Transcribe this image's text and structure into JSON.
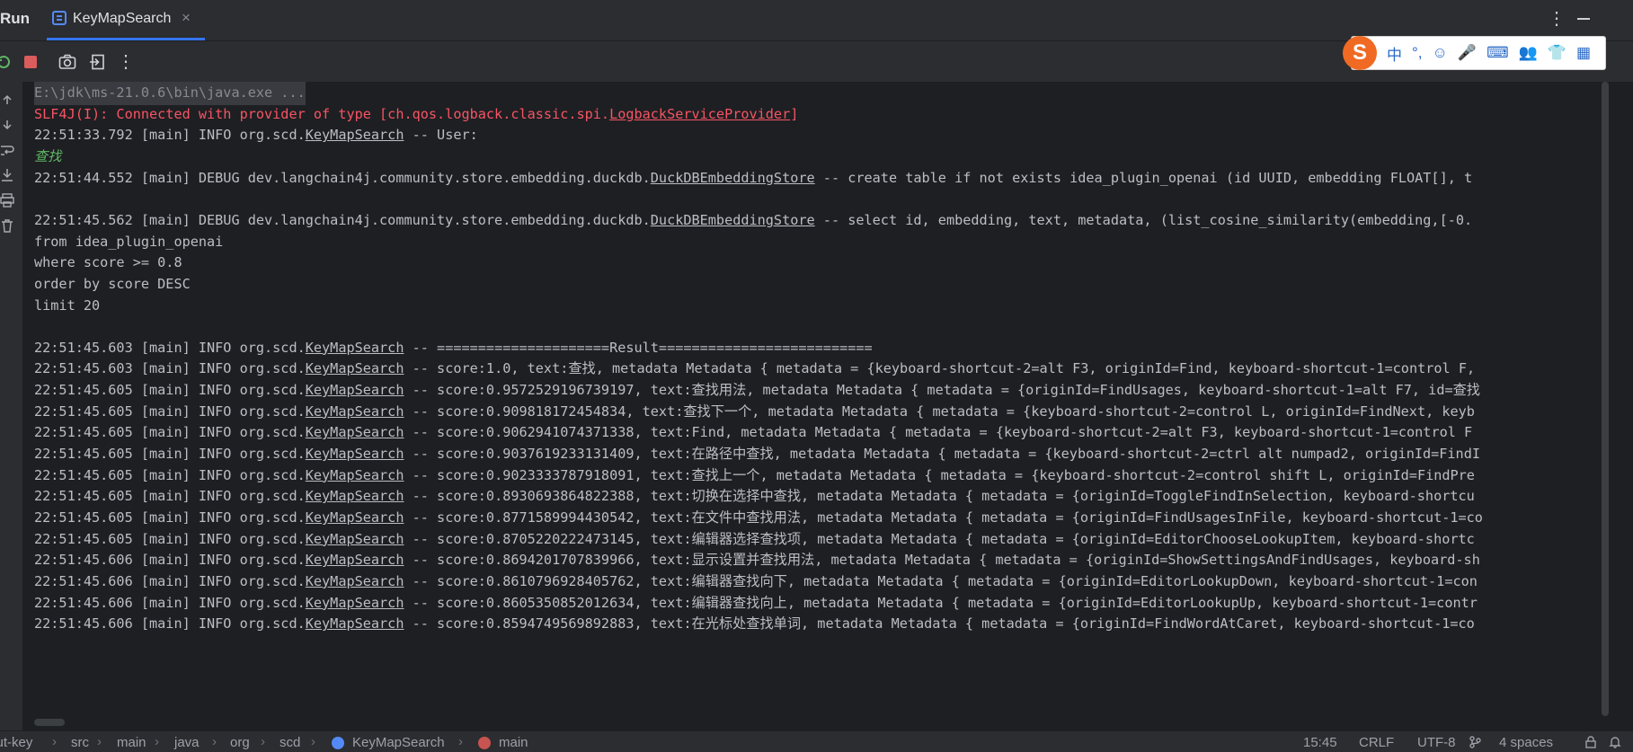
{
  "panel": {
    "title": "Run"
  },
  "tab": {
    "label": "KeyMapSearch",
    "close": "×"
  },
  "window": {
    "more": "⋮"
  },
  "toolbar": {
    "more": "⋮"
  },
  "ime": {
    "logo": "S",
    "items": [
      "中",
      "°,",
      "☺",
      "🎤",
      "⌨",
      "👥",
      "👕",
      "▦"
    ]
  },
  "console": {
    "lines": [
      {
        "style": "gray",
        "parts": [
          {
            "t": "E:\\jdk\\ms-21.0.6\\bin\\java.exe ..."
          }
        ]
      },
      {
        "style": "red",
        "parts": [
          {
            "t": "SLF4J(I): Connected with provider of type [ch.qos.logback.classic.spi."
          },
          {
            "t": "LogbackServiceProvider",
            "link": true
          },
          {
            "t": "]"
          }
        ]
      },
      {
        "style": "normal",
        "parts": [
          {
            "t": "22:51:33.792 [main] INFO org.scd."
          },
          {
            "t": "KeyMapSearch",
            "link": true
          },
          {
            "t": " -- User:"
          }
        ]
      },
      {
        "style": "green",
        "parts": [
          {
            "t": "查找"
          }
        ]
      },
      {
        "style": "normal",
        "parts": [
          {
            "t": "22:51:44.552 [main] DEBUG dev.langchain4j.community.store.embedding.duckdb."
          },
          {
            "t": "DuckDBEmbeddingStore",
            "link": true
          },
          {
            "t": " -- create table if not exists idea_plugin_openai (id UUID, embedding FLOAT[], t"
          }
        ]
      },
      {
        "style": "normal",
        "parts": [
          {
            "t": ""
          }
        ]
      },
      {
        "style": "normal",
        "parts": [
          {
            "t": "22:51:45.562 [main] DEBUG dev.langchain4j.community.store.embedding.duckdb."
          },
          {
            "t": "DuckDBEmbeddingStore",
            "link": true
          },
          {
            "t": " -- select id, embedding, text, metadata, (list_cosine_similarity(embedding,[-0."
          }
        ]
      },
      {
        "style": "normal",
        "parts": [
          {
            "t": "from idea_plugin_openai"
          }
        ]
      },
      {
        "style": "normal",
        "parts": [
          {
            "t": "where score >= 0.8"
          }
        ]
      },
      {
        "style": "normal",
        "parts": [
          {
            "t": "order by score DESC"
          }
        ]
      },
      {
        "style": "normal",
        "parts": [
          {
            "t": "limit 20"
          }
        ]
      },
      {
        "style": "normal",
        "parts": [
          {
            "t": ""
          }
        ]
      },
      {
        "style": "normal",
        "parts": [
          {
            "t": "22:51:45.603 [main] INFO org.scd."
          },
          {
            "t": "KeyMapSearch",
            "link": true
          },
          {
            "t": " -- =====================Result=========================="
          }
        ]
      },
      {
        "style": "normal",
        "parts": [
          {
            "t": "22:51:45.603 [main] INFO org.scd."
          },
          {
            "t": "KeyMapSearch",
            "link": true
          },
          {
            "t": " -- score:1.0, text:查找, metadata Metadata { metadata = {keyboard-shortcut-2=alt F3, originId=Find, keyboard-shortcut-1=control F,"
          }
        ]
      },
      {
        "style": "normal",
        "parts": [
          {
            "t": "22:51:45.605 [main] INFO org.scd."
          },
          {
            "t": "KeyMapSearch",
            "link": true
          },
          {
            "t": " -- score:0.9572529196739197, text:查找用法, metadata Metadata { metadata = {originId=FindUsages, keyboard-shortcut-1=alt F7, id=查找"
          }
        ]
      },
      {
        "style": "normal",
        "parts": [
          {
            "t": "22:51:45.605 [main] INFO org.scd."
          },
          {
            "t": "KeyMapSearch",
            "link": true
          },
          {
            "t": " -- score:0.909818172454834, text:查找下一个, metadata Metadata { metadata = {keyboard-shortcut-2=control L, originId=FindNext, keyb"
          }
        ]
      },
      {
        "style": "normal",
        "parts": [
          {
            "t": "22:51:45.605 [main] INFO org.scd."
          },
          {
            "t": "KeyMapSearch",
            "link": true
          },
          {
            "t": " -- score:0.9062941074371338, text:Find, metadata Metadata { metadata = {keyboard-shortcut-2=alt F3, keyboard-shortcut-1=control F"
          }
        ]
      },
      {
        "style": "normal",
        "parts": [
          {
            "t": "22:51:45.605 [main] INFO org.scd."
          },
          {
            "t": "KeyMapSearch",
            "link": true
          },
          {
            "t": " -- score:0.9037619233131409, text:在路径中查找, metadata Metadata { metadata = {keyboard-shortcut-2=ctrl alt numpad2, originId=FindI"
          }
        ]
      },
      {
        "style": "normal",
        "parts": [
          {
            "t": "22:51:45.605 [main] INFO org.scd."
          },
          {
            "t": "KeyMapSearch",
            "link": true
          },
          {
            "t": " -- score:0.9023333787918091, text:查找上一个, metadata Metadata { metadata = {keyboard-shortcut-2=control shift L, originId=FindPre"
          }
        ]
      },
      {
        "style": "normal",
        "parts": [
          {
            "t": "22:51:45.605 [main] INFO org.scd."
          },
          {
            "t": "KeyMapSearch",
            "link": true
          },
          {
            "t": " -- score:0.8930693864822388, text:切换在选择中查找, metadata Metadata { metadata = {originId=ToggleFindInSelection, keyboard-shortcu"
          }
        ]
      },
      {
        "style": "normal",
        "parts": [
          {
            "t": "22:51:45.605 [main] INFO org.scd."
          },
          {
            "t": "KeyMapSearch",
            "link": true
          },
          {
            "t": " -- score:0.8771589994430542, text:在文件中查找用法, metadata Metadata { metadata = {originId=FindUsagesInFile, keyboard-shortcut-1=co"
          }
        ]
      },
      {
        "style": "normal",
        "parts": [
          {
            "t": "22:51:45.605 [main] INFO org.scd."
          },
          {
            "t": "KeyMapSearch",
            "link": true
          },
          {
            "t": " -- score:0.8705220222473145, text:编辑器选择查找项, metadata Metadata { metadata = {originId=EditorChooseLookupItem, keyboard-shortc"
          }
        ]
      },
      {
        "style": "normal",
        "parts": [
          {
            "t": "22:51:45.606 [main] INFO org.scd."
          },
          {
            "t": "KeyMapSearch",
            "link": true
          },
          {
            "t": " -- score:0.8694201707839966, text:显示设置并查找用法, metadata Metadata { metadata = {originId=ShowSettingsAndFindUsages, keyboard-sh"
          }
        ]
      },
      {
        "style": "normal",
        "parts": [
          {
            "t": "22:51:45.606 [main] INFO org.scd."
          },
          {
            "t": "KeyMapSearch",
            "link": true
          },
          {
            "t": " -- score:0.8610796928405762, text:编辑器查找向下, metadata Metadata { metadata = {originId=EditorLookupDown, keyboard-shortcut-1=con"
          }
        ]
      },
      {
        "style": "normal",
        "parts": [
          {
            "t": "22:51:45.606 [main] INFO org.scd."
          },
          {
            "t": "KeyMapSearch",
            "link": true
          },
          {
            "t": " -- score:0.8605350852012634, text:编辑器查找向上, metadata Metadata { metadata = {originId=EditorLookupUp, keyboard-shortcut-1=contr"
          }
        ]
      },
      {
        "style": "normal",
        "parts": [
          {
            "t": "22:51:45.606 [main] INFO org.scd."
          },
          {
            "t": "KeyMapSearch",
            "link": true
          },
          {
            "t": " -- score:0.8594749569892883, text:在光标处查找单词, metadata Metadata { metadata = {originId=FindWordAtCaret, keyboard-shortcut-1=co"
          }
        ]
      }
    ]
  },
  "statusbar": {
    "breadcrumbs": [
      "cut-key",
      "src",
      "main",
      "java",
      "org",
      "scd",
      "KeyMapSearch",
      "main"
    ],
    "separator": "›",
    "position": "15:45",
    "line_ending": "CRLF",
    "encoding": "UTF-8",
    "indent": "4 spaces"
  },
  "colors": {
    "accent": "#3574f0",
    "background": "#1e1f22",
    "panel": "#2b2d30",
    "error": "#f75464",
    "stop": "#db5c5c"
  }
}
